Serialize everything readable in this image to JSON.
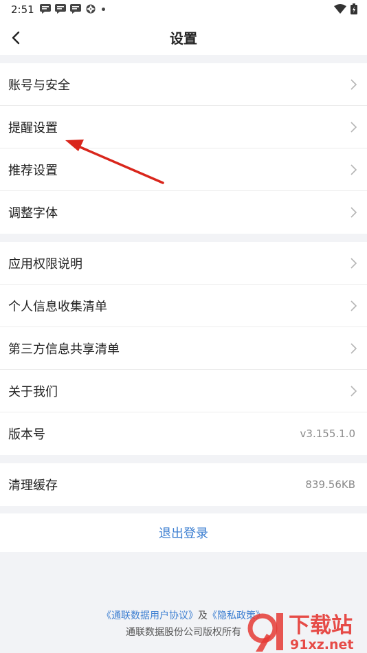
{
  "status_bar": {
    "time": "2:51",
    "notification_icons": [
      "message-icon",
      "message-icon",
      "message-icon",
      "shutter-icon"
    ],
    "right_icons": [
      "wifi-icon",
      "battery-icon"
    ]
  },
  "header": {
    "title": "设置",
    "back_icon": "chevron-left-icon"
  },
  "groups": [
    {
      "items": [
        {
          "label": "账号与安全"
        },
        {
          "label": "提醒设置"
        },
        {
          "label": "推荐设置"
        },
        {
          "label": "调整字体"
        }
      ]
    },
    {
      "items": [
        {
          "label": "应用权限说明"
        },
        {
          "label": "个人信息收集清单"
        },
        {
          "label": "第三方信息共享清单"
        },
        {
          "label": "关于我们"
        },
        {
          "label": "版本号",
          "value": "v3.155.1.0"
        }
      ]
    },
    {
      "items": [
        {
          "label": "清理缓存",
          "value": "839.56KB"
        }
      ]
    }
  ],
  "logout": {
    "label": "退出登录"
  },
  "footer": {
    "agreement_link": "《通联数据用户协议》",
    "conjunction": "及",
    "privacy_link": "《隐私政策》",
    "copyright": "通联数据股份公司版权所有"
  },
  "watermark": {
    "brand": "下载站",
    "domain": "91xz.net"
  },
  "colors": {
    "accent": "#3d7fd1",
    "annotation": "#d9261c",
    "background": "#f2f3f6"
  }
}
